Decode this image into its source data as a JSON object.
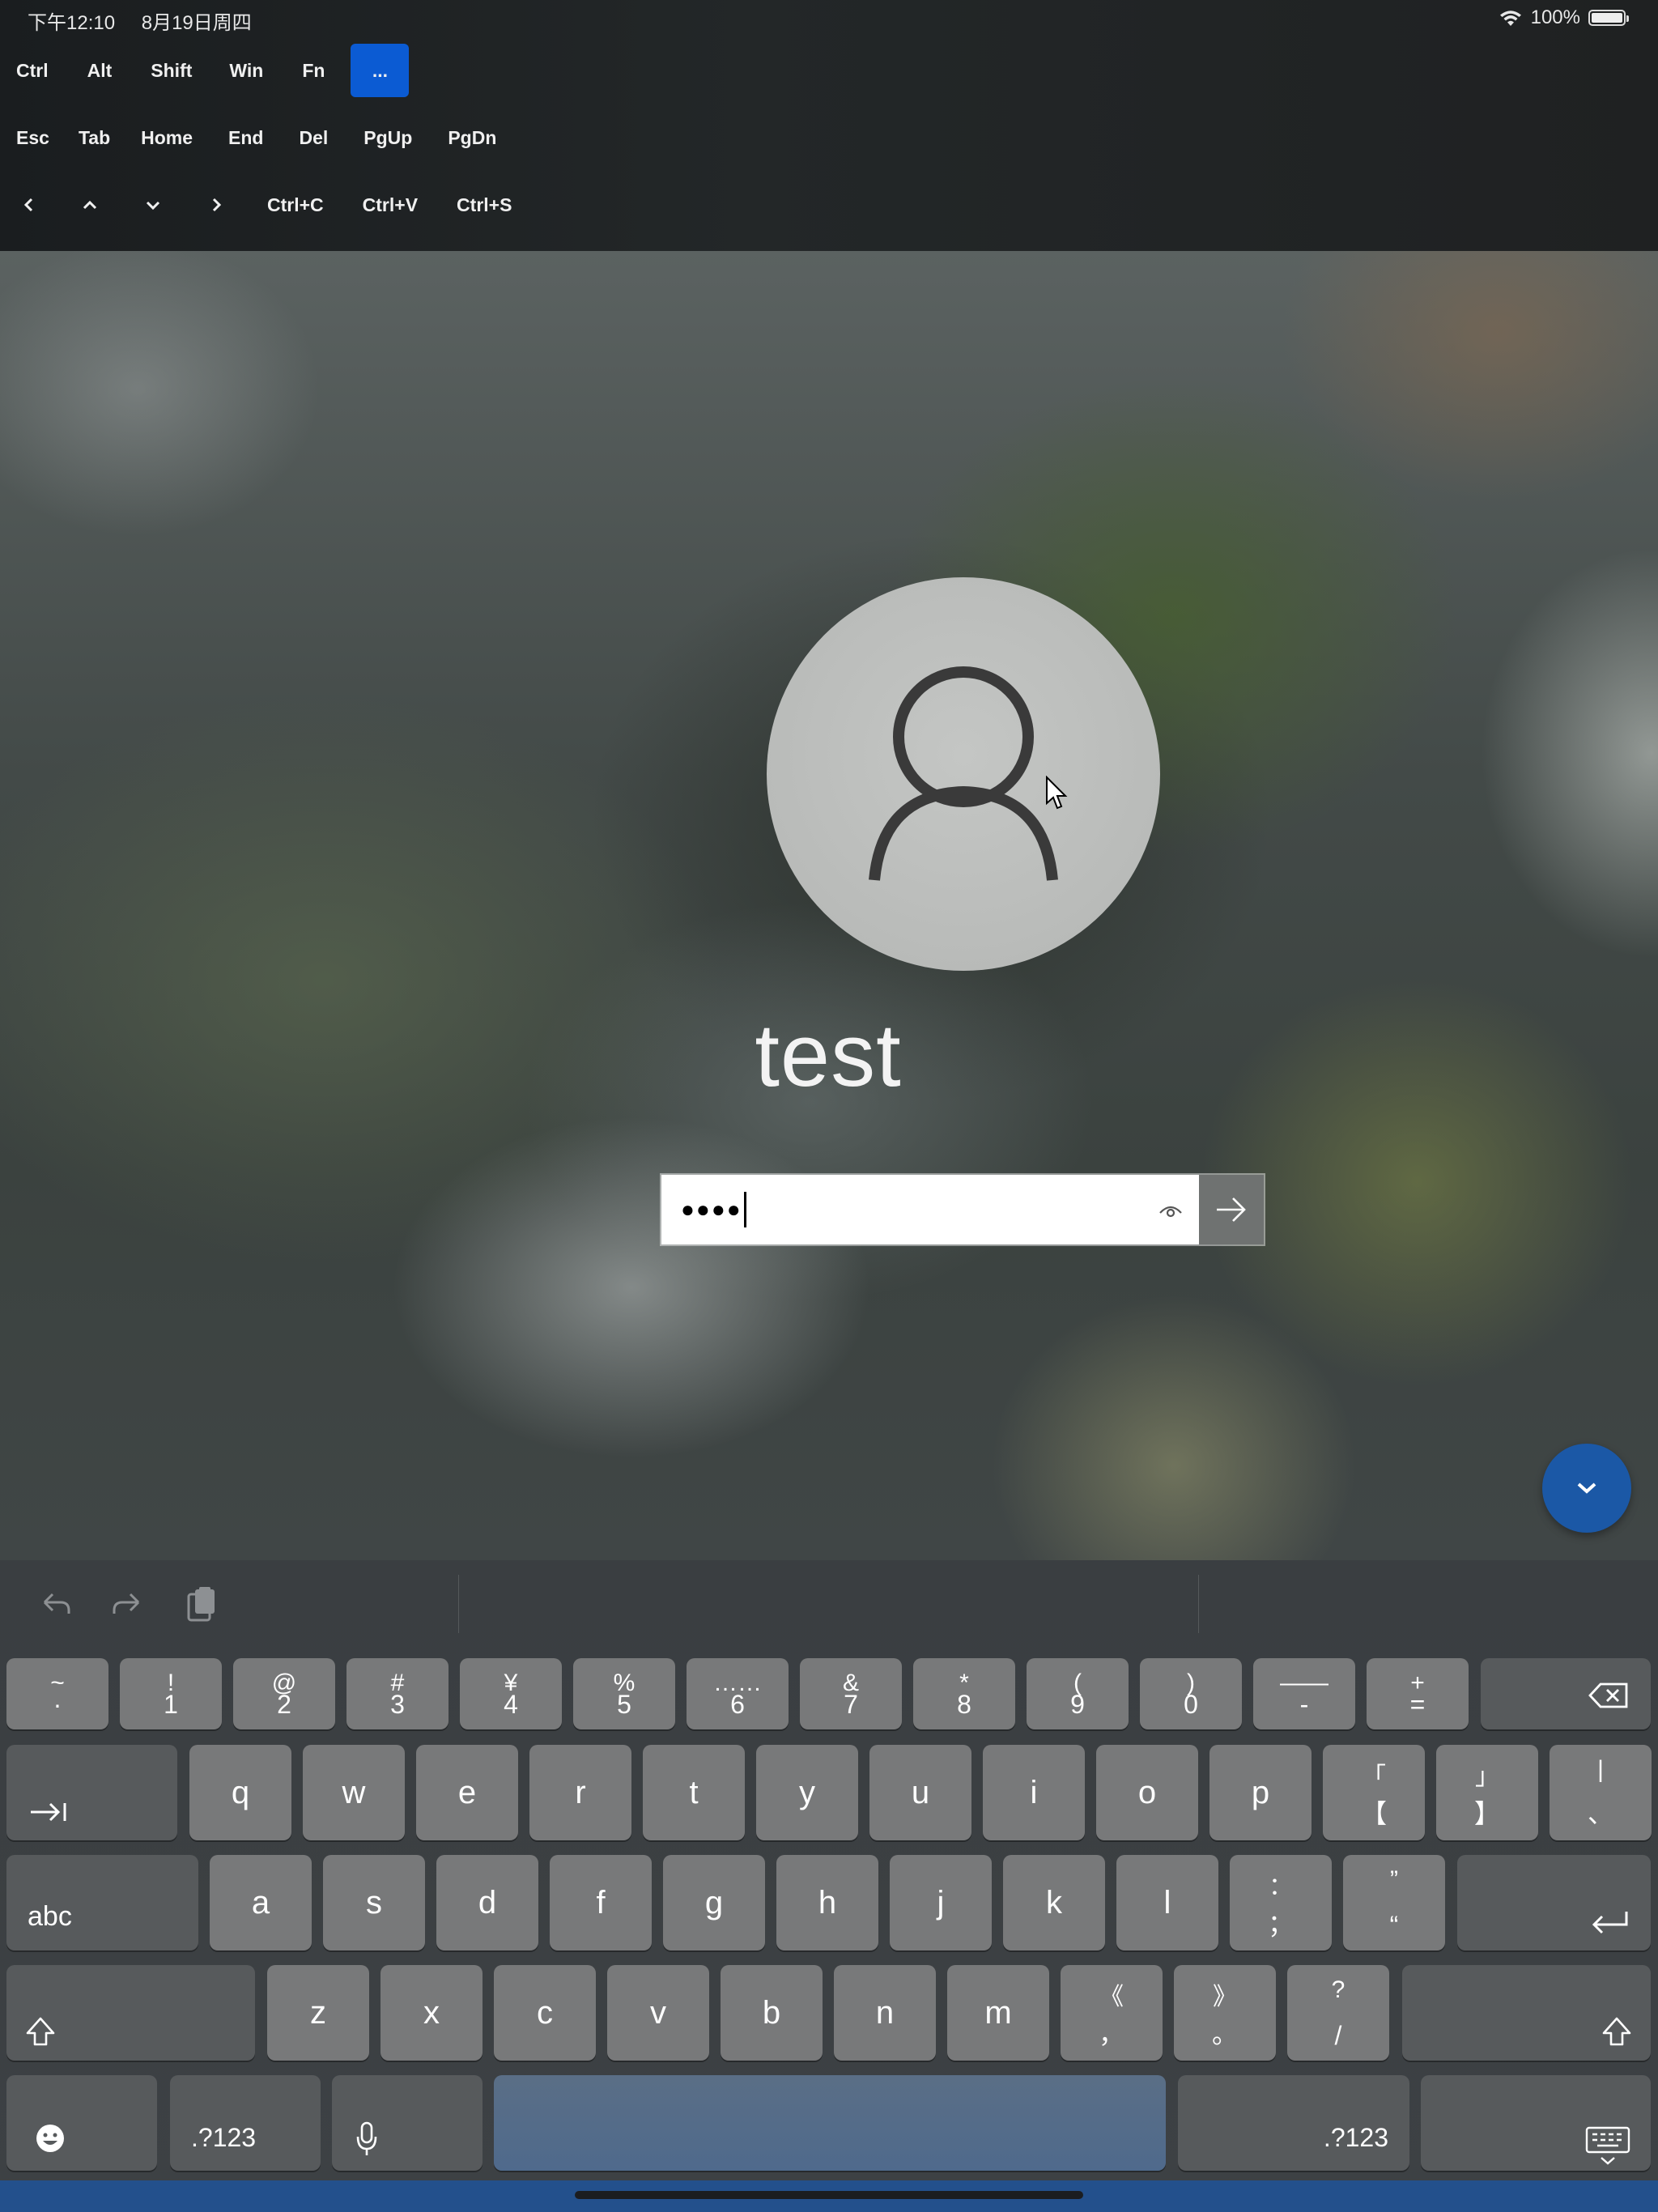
{
  "status_bar": {
    "time": "下午12:10",
    "date": "8月19日周四",
    "battery": "100%",
    "battery_level": 1.0
  },
  "toolbar": {
    "row1": [
      "Ctrl",
      "Alt",
      "Shift",
      "Win",
      "Fn",
      "..."
    ],
    "row2": [
      "Esc",
      "Tab",
      "Home",
      "End",
      "Del",
      "PgUp",
      "PgDn"
    ],
    "row3_shortcuts": [
      "Ctrl+C",
      "Ctrl+V",
      "Ctrl+S"
    ],
    "arrows": [
      "left-arrow-icon",
      "up-arrow-icon",
      "down-arrow-icon",
      "right-arrow-icon"
    ],
    "active_color": "#0b5bd3"
  },
  "login": {
    "username": "test",
    "password_mask": "●●●●",
    "password_length": 4,
    "reveal_icon": "eye-icon",
    "submit_icon": "arrow-right-icon",
    "fab_icon": "chevron-down-icon",
    "fab_color": "#1b58a6"
  },
  "keyboard": {
    "toolbar_icons": [
      "undo-icon",
      "redo-icon",
      "clipboard-icon"
    ],
    "number_row": [
      {
        "top": "~",
        "bot": "·"
      },
      {
        "top": "!",
        "bot": "1"
      },
      {
        "top": "@",
        "bot": "2"
      },
      {
        "top": "#",
        "bot": "3"
      },
      {
        "top": "¥",
        "bot": "4"
      },
      {
        "top": "%",
        "bot": "5"
      },
      {
        "top": "……",
        "bot": "6"
      },
      {
        "top": "&",
        "bot": "7"
      },
      {
        "top": "*",
        "bot": "8"
      },
      {
        "top": "(",
        "bot": "9"
      },
      {
        "top": ")",
        "bot": "0"
      },
      {
        "top": "——",
        "bot": "-"
      },
      {
        "top": "+",
        "bot": "="
      }
    ],
    "row_q": [
      "q",
      "w",
      "e",
      "r",
      "t",
      "y",
      "u",
      "i",
      "o",
      "p"
    ],
    "row_q_extra": [
      {
        "top": "「",
        "bot": "【"
      },
      {
        "top": "」",
        "bot": "】"
      },
      {
        "top": "|",
        "bot": "、"
      }
    ],
    "row_a": [
      "a",
      "s",
      "d",
      "f",
      "g",
      "h",
      "j",
      "k",
      "l"
    ],
    "row_a_extra": [
      {
        "top": "：",
        "bot": "；"
      },
      {
        "top": "”",
        "bot": "“"
      }
    ],
    "row_z": [
      "z",
      "x",
      "c",
      "v",
      "b",
      "n",
      "m"
    ],
    "row_z_extra": [
      {
        "top": "《",
        "bot": "，"
      },
      {
        "top": "》",
        "bot": "。"
      },
      {
        "top": "?",
        "bot": "/"
      }
    ],
    "abc_label": "abc",
    "num_label": ".?123",
    "num_label_right": ".?123",
    "accent_space": "#4f6a8c"
  }
}
